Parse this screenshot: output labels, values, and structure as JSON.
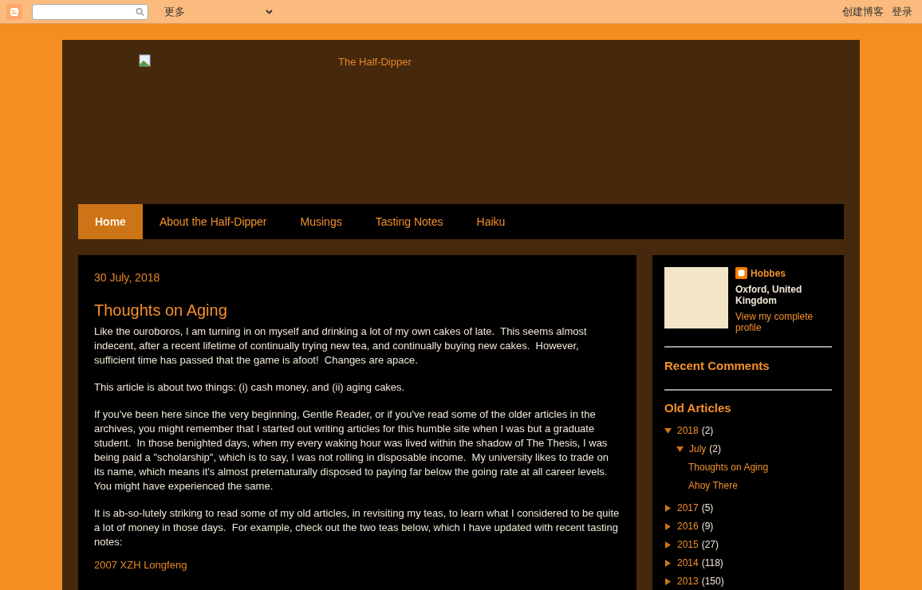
{
  "navbar": {
    "more_menu": "更多",
    "links": [
      "创建博客",
      "登录"
    ]
  },
  "header": {
    "title": "The Half-Dipper"
  },
  "tabs": [
    {
      "label": "Home",
      "selected": true
    },
    {
      "label": "About the Half-Dipper",
      "selected": false
    },
    {
      "label": "Musings",
      "selected": false
    },
    {
      "label": "Tasting Notes",
      "selected": false
    },
    {
      "label": "Haiku",
      "selected": false
    }
  ],
  "post": {
    "date": "30 July, 2018",
    "title": "Thoughts on Aging",
    "paragraphs": [
      "Like the ouroboros, I am turning in on myself and drinking a lot of my own cakes of late.  This seems almost indecent, after a recent lifetime of continually trying new tea, and continually buying new cakes.  However, sufficient time has passed that the game is afoot!  Changes are apace.",
      "This article is about two things: (i) cash money, and (ii) aging cakes.",
      "If you've been here since the very beginning, Gentle Reader, or if you've read some of the older articles in the archives, you might remember that I started out writing articles for this humble site when I was but a graduate student.  In those benighted days, when my every waking hour was lived within the shadow of The Thesis, I was being paid a \"scholarship\", which is to say, I was not rolling in disposable income.  My university likes to trade on its name, which means it's almost preternaturally disposed to paying far below the going rate at all career levels.  You might have experienced the same.",
      "It is ab-so-lutely striking to read some of my old articles, in revisiting my teas, to learn what I considered to be quite a lot of money in those days.  For example, check out the two teas below, which I have updated with recent tasting notes:"
    ],
    "link": "2007 XZH Longfeng"
  },
  "sidebar": {
    "profile": {
      "name": "Hobbes",
      "location": "Oxford, United Kingdom",
      "link": "View my complete profile"
    },
    "recent_comments": {
      "title": "Recent Comments"
    },
    "archive": {
      "title": "Old Articles",
      "items": [
        {
          "label": "2018",
          "count": "(2)",
          "expanded": true,
          "children": [
            {
              "label": "July",
              "count": "(2)",
              "expanded": true,
              "children": [
                {
                  "label": "Thoughts on Aging"
                },
                {
                  "label": "Ahoy There"
                }
              ]
            }
          ]
        },
        {
          "label": "2017",
          "count": "(5)",
          "expanded": false
        },
        {
          "label": "2016",
          "count": "(9)",
          "expanded": false
        },
        {
          "label": "2015",
          "count": "(27)",
          "expanded": false
        },
        {
          "label": "2014",
          "count": "(118)",
          "expanded": false
        },
        {
          "label": "2013",
          "count": "(150)",
          "expanded": false
        }
      ]
    }
  }
}
